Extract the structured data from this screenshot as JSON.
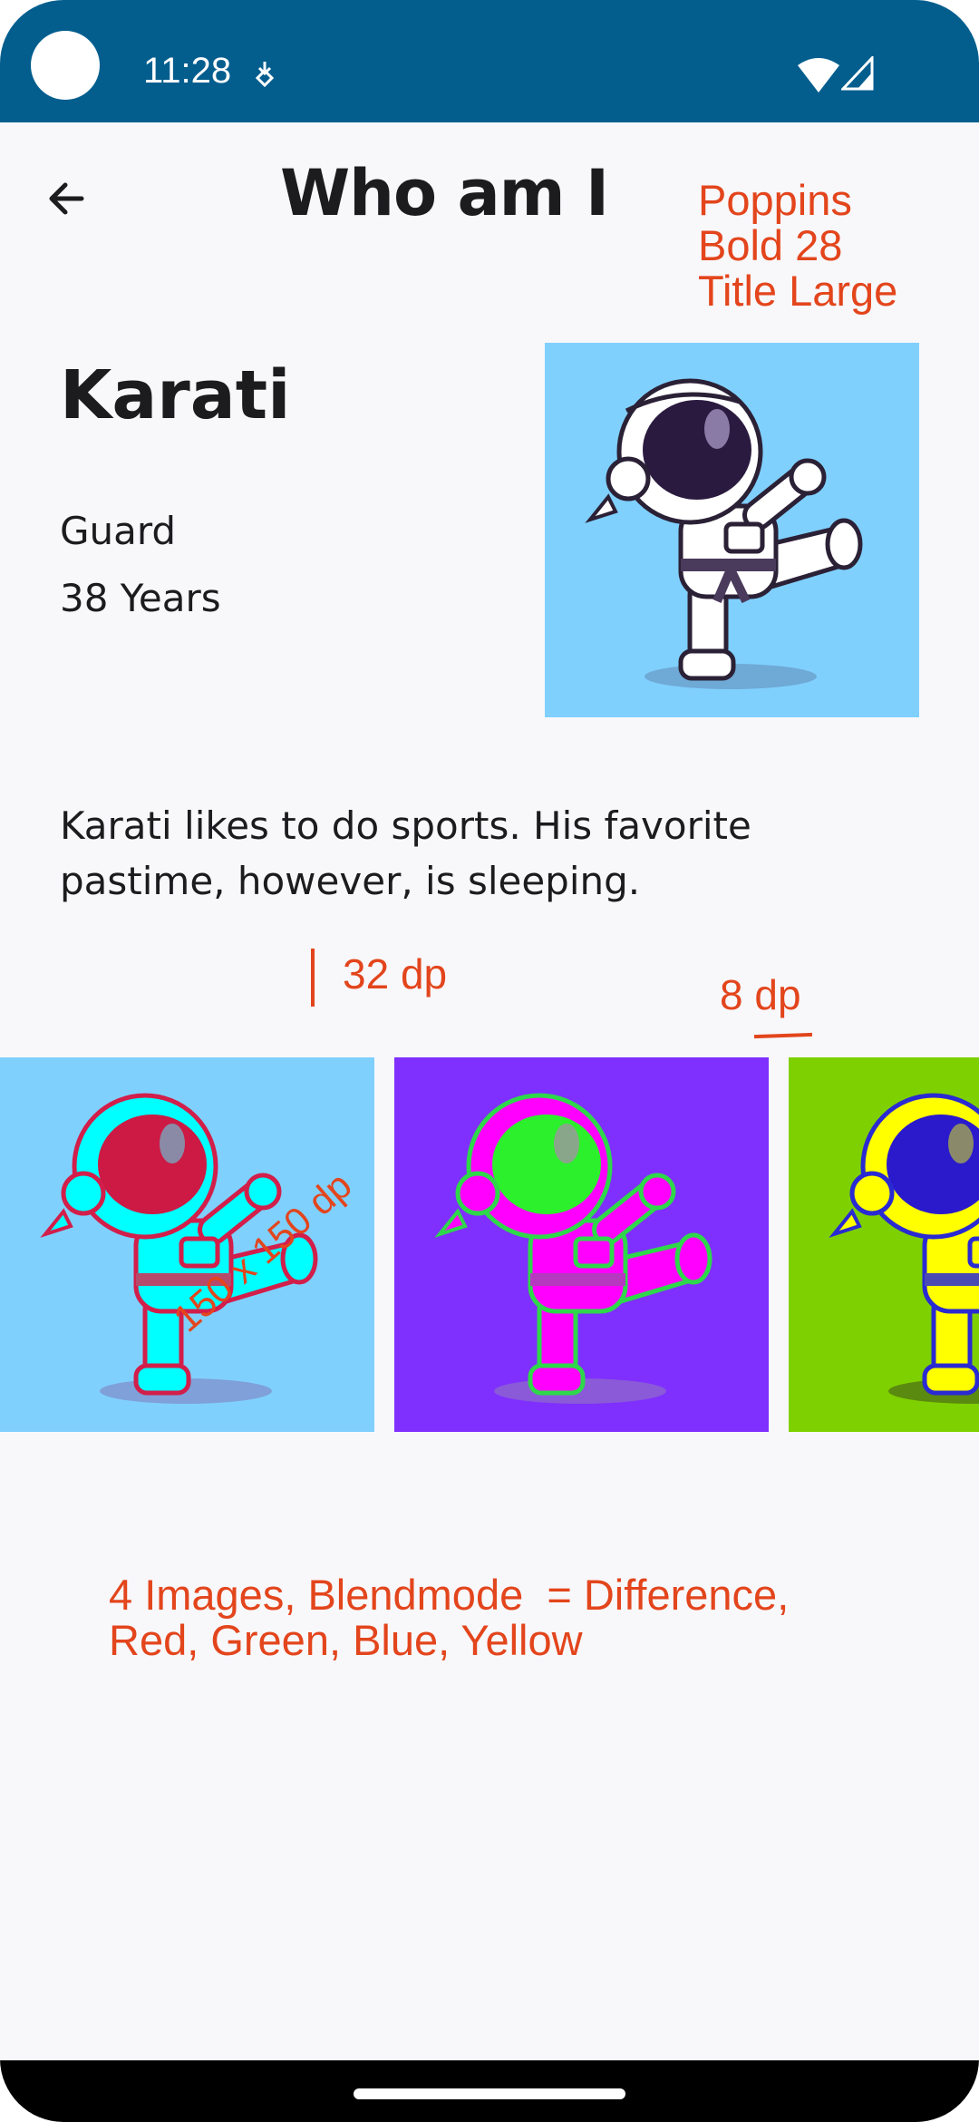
{
  "status_bar": {
    "time": "11:28",
    "icons": [
      "camera-cutout-icon",
      "download-notification-icon",
      "wifi-icon",
      "cellular-signal-icon"
    ],
    "background": "#035e8e"
  },
  "app_bar": {
    "title": "Who am I",
    "back_icon": "arrow-left-icon"
  },
  "profile": {
    "name": "Karati",
    "role": "Guard",
    "age": "38 Years",
    "description": "Karati likes to do sports. His favorite pastime, however, is sleeping.",
    "image": "karate-astronaut-illustration"
  },
  "gallery": {
    "tiles": [
      {
        "name": "gallery-image-red",
        "background": "#80d0fe"
      },
      {
        "name": "gallery-image-green",
        "background": "#7f2ffe"
      },
      {
        "name": "gallery-image-blue",
        "background": "#7fd000"
      }
    ]
  },
  "annotations": {
    "title_spec": [
      "Poppins",
      "Bold 28",
      "Title Large"
    ],
    "spacing_32": "32 dp",
    "spacing_8": "8 dp",
    "tile_size": "150 x 150 dp",
    "note": [
      "4 Images, Blendmode  = Difference,",
      "Red, Green, Blue, Yellow"
    ],
    "color": "#e3451c"
  }
}
